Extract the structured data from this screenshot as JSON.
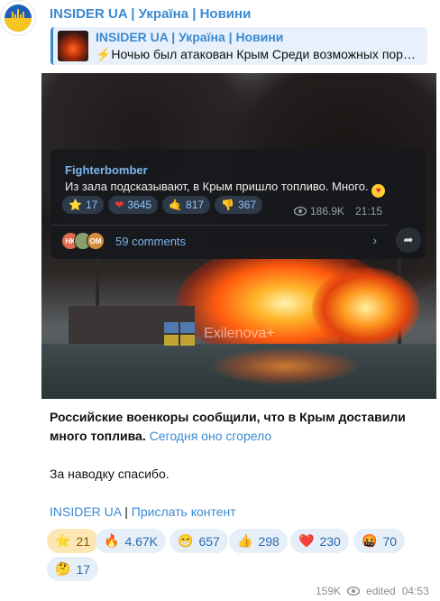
{
  "channel": {
    "name": "INSIDER UA | Україна | Новини"
  },
  "reply": {
    "title": "INSIDER UA | Україна | Новини",
    "preview": "⚡Ночью был атакован Крым Среди возможных пор…"
  },
  "photo": {
    "watermark": "Exilenova+",
    "tg_card": {
      "author": "Fighterbomber",
      "text": "Из зала подсказывают, в Крым пришло топливо. Много.",
      "reactions": [
        {
          "emoji": "⭐",
          "count": "17"
        },
        {
          "emoji": "❤",
          "count": "3645"
        },
        {
          "emoji": "🤙",
          "count": "817"
        },
        {
          "emoji": "👎",
          "count": "367"
        }
      ],
      "views": "186.9K",
      "time": "21:15",
      "avatars": [
        "HK",
        "",
        "OM"
      ],
      "comments": "59 comments"
    }
  },
  "post": {
    "bold_text": "Российские военкоры сообщили, что в Крым доставили много топлива.",
    "link_text": "Сегодня оно сгорело",
    "thanks": "За наводку спасибо.",
    "sig_channel": "INSIDER UA",
    "sig_sep": " | ",
    "sig_link": "Прислать контент"
  },
  "reactions": [
    {
      "emoji": "⭐",
      "count": "21"
    },
    {
      "emoji": "🔥",
      "count": "4.67K"
    },
    {
      "emoji": "😁",
      "count": "657"
    },
    {
      "emoji": "👍",
      "count": "298"
    },
    {
      "emoji": "❤️",
      "count": "230"
    },
    {
      "emoji": "🤬",
      "count": "70"
    },
    {
      "emoji": "🤔",
      "count": "17"
    }
  ],
  "footer": {
    "views": "159K",
    "status": "edited",
    "time": "04:53"
  },
  "colors": {
    "accent": "#3a8ad1",
    "reply_bg": "#e8f1fb",
    "reaction_bg": "#e6eef8",
    "star_reaction_bg": "#fbe6b4"
  }
}
